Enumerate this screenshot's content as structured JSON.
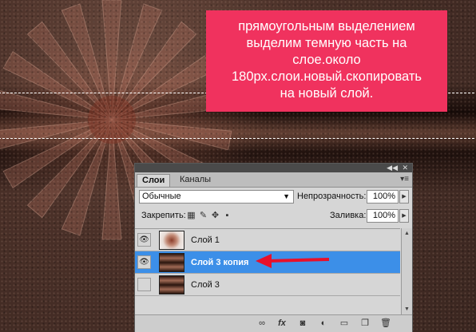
{
  "annotation": {
    "lines": [
      "прямоугольным выделением",
      "выделим темную часть на",
      "слое.около",
      "180рх.слои.новый.скопировать",
      "на новый слой."
    ]
  },
  "panel": {
    "tabs": [
      {
        "label": "Слои",
        "active": true
      },
      {
        "label": "Каналы",
        "active": false
      }
    ],
    "blend_mode": "Обычные",
    "opacity_label": "Непрозрачность:",
    "opacity_value": "100%",
    "lock_label": "Закрепить:",
    "fill_label": "Заливка:",
    "fill_value": "100%",
    "layers": [
      {
        "name": "Слой 1",
        "visible": true,
        "selected": false
      },
      {
        "name": "Слой 3 копия",
        "visible": true,
        "selected": true
      },
      {
        "name": "Слой 3",
        "visible": false,
        "selected": false
      }
    ],
    "bottom_buttons": [
      "link-icon",
      "fx-icon",
      "mask-icon",
      "adjustment-icon",
      "folder-icon",
      "new-layer-icon",
      "trash-icon"
    ],
    "fx_label": "fx"
  },
  "colors": {
    "annotation_bg": "#f0325e",
    "selection_highlight": "#3c8fe8",
    "arrow": "#e8102a"
  }
}
